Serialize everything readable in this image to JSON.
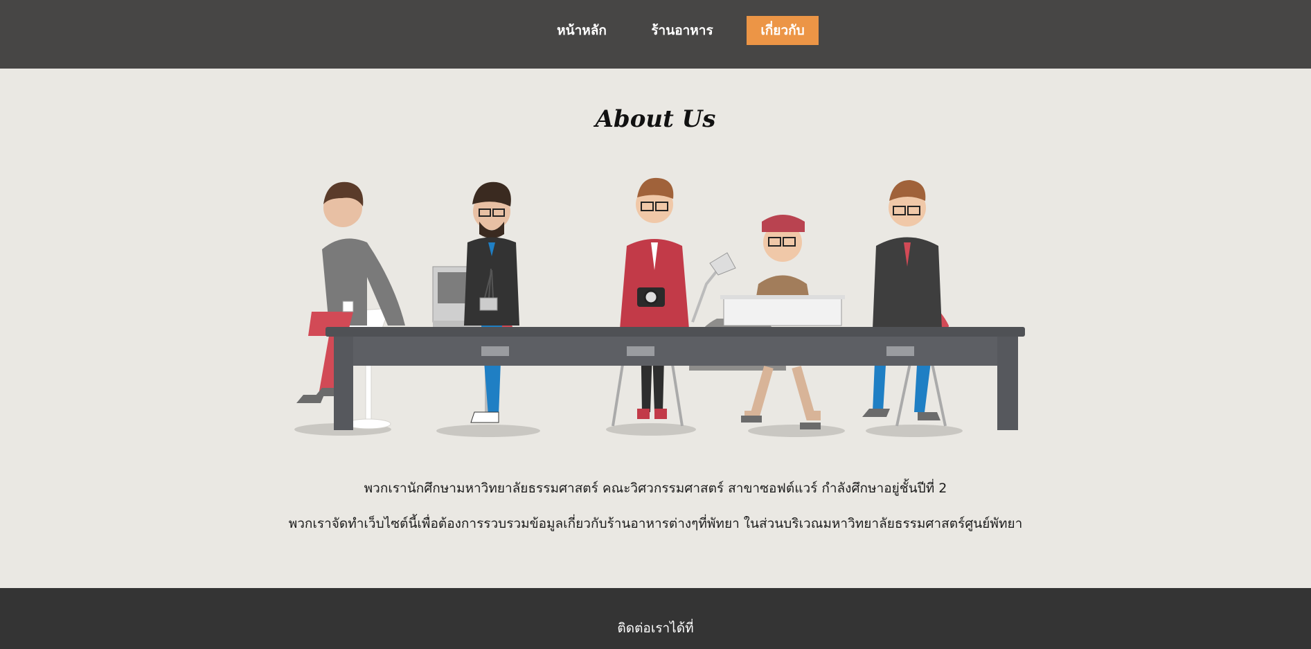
{
  "nav": {
    "items": [
      {
        "label": "หน้าหลัก"
      },
      {
        "label": "ร้านอาหาร"
      },
      {
        "label": "เกี่ยวกับ",
        "active": true
      }
    ],
    "active_color": "#ec9546",
    "background": "#474645"
  },
  "main": {
    "title": "About Us",
    "paragraph_1": "พวกเรานักศึกษามหาวิทยาลัยธรรมศาสตร์ คณะวิศวกรรมศาสตร์ สาขาซอฟต์แวร์ กำลังศึกษาอยู่ชั้นปีที่ 2",
    "paragraph_2": "พวกเราจัดทำเว็บไซต์นี้เพื่อต้องการรวบรวมข้อมูลเกี่ยวกับร้านอาหารต่างๆที่พัทยา ในส่วนบริเวณมหาวิทยาลัยธรรมศาสตร์ศูนย์พัทยา",
    "background": "#eae8e3"
  },
  "footer": {
    "contact_label": "ติดต่อเราได้ที่",
    "background": "#343434"
  }
}
